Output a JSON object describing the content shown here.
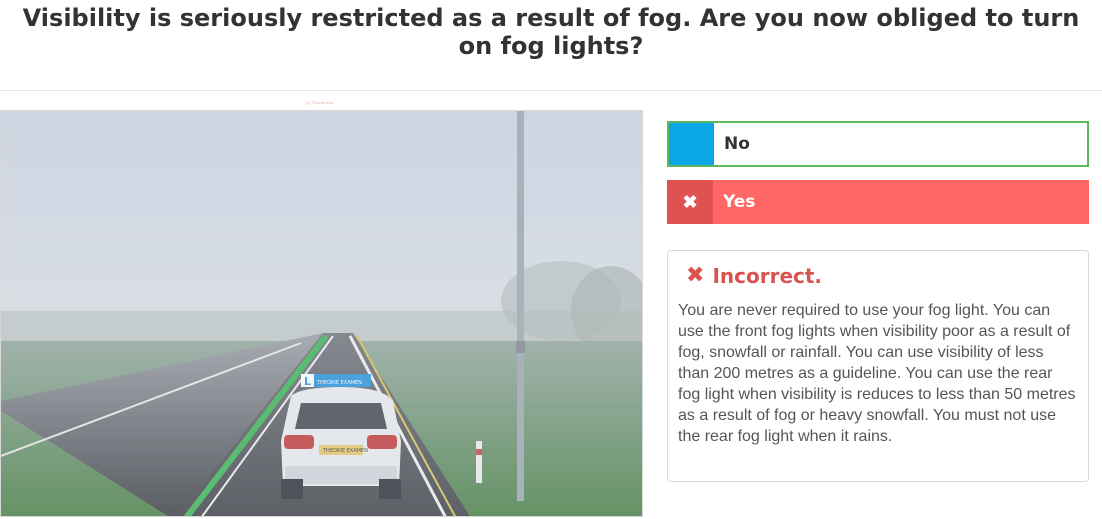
{
  "question": {
    "text": "Visibility is seriously restricted as a result of fog. Are you now obliged to turn on fog lights?"
  },
  "scene": {
    "caption": "(c) Theorie.info",
    "plate_text": "THEORIE EXAMEN",
    "bumper_text": "THEORIE EXAMEN"
  },
  "answers": [
    {
      "label": "No",
      "state": "correct",
      "marker_color": "#0aa6e6",
      "icon": "blank"
    },
    {
      "label": "Yes",
      "state": "selected-wrong",
      "marker_color": "#e05252",
      "icon": "x-icon"
    }
  ],
  "feedback": {
    "icon": "x-icon",
    "title": "Incorrect.",
    "text": "You are never required to use your fog light. You can use the front fog lights when visibility poor as a result of fog, snowfall or rainfall. You can use visibility of less than 200 metres as a guideline. You can use the rear fog light when visibility is reduces to less than 50 metres as a result of fog or heavy snowfall. You must not use the rear fog light when it rains.",
    "color": "#d9534f"
  },
  "colors": {
    "correct_border": "#5cb85c",
    "wrong_fill": "#ff6666"
  }
}
